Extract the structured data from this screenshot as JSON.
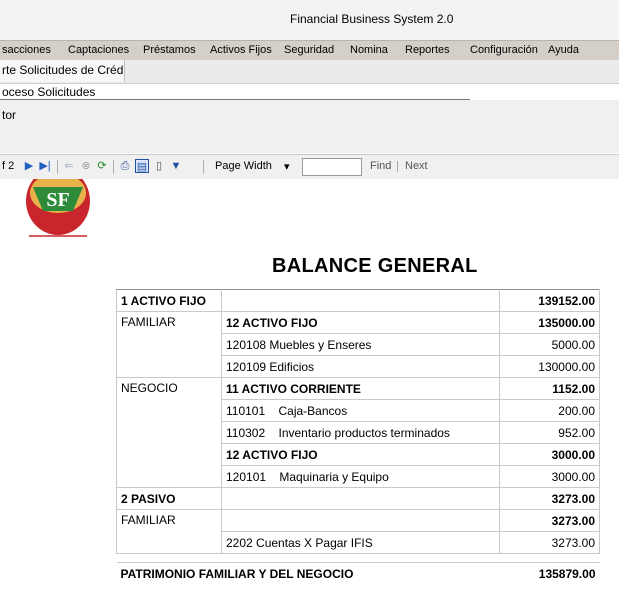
{
  "window": {
    "title": "Financial Business System 2.0"
  },
  "menu": [
    "sacciones",
    "Captaciones",
    "Préstamos",
    "Activos Fijos",
    "Seguridad",
    "Nomina",
    "Reportes",
    "Configuración",
    "Ayuda"
  ],
  "tabs": {
    "tab1": "rte Solicitudes de Crédito",
    "tab2": "oceso Solicitudes"
  },
  "panel": {
    "label": "tor"
  },
  "toolbar": {
    "page_of": "f 2",
    "zoom": "Page Width",
    "find_value": "",
    "find_label": "Find",
    "separator": "|",
    "next_label": "Next"
  },
  "logo": {
    "text": "SF"
  },
  "report": {
    "title": "BALANCE GENERAL",
    "rows": [
      {
        "c1": "1 ACTIVO FIJO",
        "c2": "",
        "c3": "139152.00"
      },
      {
        "c1": "FAMILIAR",
        "c2": "12 ACTIVO FIJO",
        "c3": "135000.00"
      },
      {
        "c1": "",
        "c2": "120108 Muebles y Enseres",
        "c3": "5000.00"
      },
      {
        "c1": "",
        "c2": "120109 Edificios",
        "c3": "130000.00"
      },
      {
        "c1": "NEGOCIO",
        "c2": "11 ACTIVO CORRIENTE",
        "c3": "1152.00"
      },
      {
        "c1": "",
        "c2": "110101    Caja-Bancos",
        "c3": "200.00"
      },
      {
        "c1": "",
        "c2": "110302    Inventario productos terminados",
        "c3": "952.00"
      },
      {
        "c1": "",
        "c2": "12 ACTIVO FIJO",
        "c3": "3000.00"
      },
      {
        "c1": "",
        "c2": "120101    Maquinaria y Equipo",
        "c3": "3000.00"
      },
      {
        "c1": "2 PASIVO",
        "c2": "",
        "c3": "3273.00"
      },
      {
        "c1": "FAMILIAR",
        "c2": "",
        "c3": "3273.00"
      },
      {
        "c1": "",
        "c2": "2202 Cuentas X Pagar IFIS",
        "c3": "3273.00"
      },
      {
        "c1": "PATRIMONIO FAMILIAR Y DEL NEGOCIO",
        "c2": "",
        "c3": "135879.00"
      }
    ]
  }
}
